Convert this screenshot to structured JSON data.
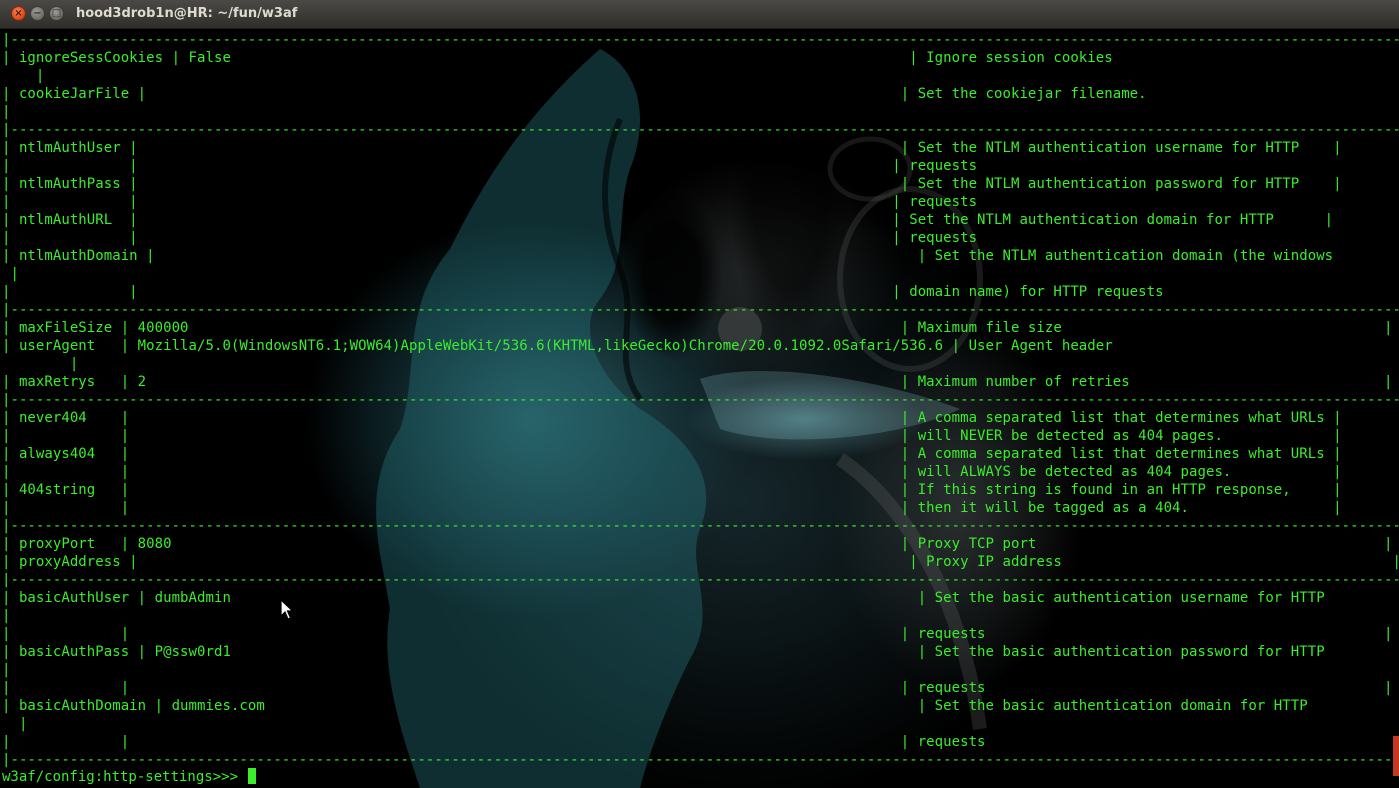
{
  "window": {
    "title": "hood3drob1n@HR: ~/fun/w3af"
  },
  "terminal": {
    "lines": [
      "|----------------------------------------------------------------------------------------------------------------------------------------------------------------------------------------|",
      "| ignoreSessCookies | False                                                                                | Ignore session cookies",
      "    |",
      "| cookieJarFile |                                                                                         | Set the cookiejar filename.",
      "|",
      "|----------------------------------------------------------------------------------------------------------------------------------------------------------------------------------------|",
      "| ntlmAuthUser |                                                                                          | Set the NTLM authentication username for HTTP    |",
      "|              |                                                                                         | requests",
      "| ntlmAuthPass |                                                                                          | Set the NTLM authentication password for HTTP    |",
      "|              |                                                                                         | requests",
      "| ntlmAuthURL  |                                                                                         | Set the NTLM authentication domain for HTTP      |",
      "|              |                                                                                         | requests",
      "| ntlmAuthDomain |                                                                                          | Set the NTLM authentication domain (the windows",
      " |",
      "|              |                                                                                         | domain name) for HTTP requests",
      "|----------------------------------------------------------------------------------------------------------------------------------------------------------------------------------------|",
      "| maxFileSize | 400000                                                                                    | Maximum file size                                      |",
      "| userAgent   | Mozilla/5.0(WindowsNT6.1;WOW64)AppleWebKit/536.6(KHTML,likeGecko)Chrome/20.0.1092.0Safari/536.6 | User Agent header",
      "        |",
      "| maxRetrys   | 2                                                                                         | Maximum number of retries                              |",
      "|----------------------------------------------------------------------------------------------------------------------------------------------------------------------------------------|",
      "| never404    |                                                                                           | A comma separated list that determines what URLs |",
      "|             |                                                                                           | will NEVER be detected as 404 pages.             |",
      "| always404   |                                                                                           | A comma separated list that determines what URLs |",
      "|             |                                                                                           | will ALWAYS be detected as 404 pages.            |",
      "| 404string   |                                                                                           | If this string is found in an HTTP response,     |",
      "|             |                                                                                           | then it will be tagged as a 404.                 |",
      "|----------------------------------------------------------------------------------------------------------------------------------------------------------------------------------------|",
      "| proxyPort   | 8080                                                                                      | Proxy TCP port                                         |",
      "| proxyAddress |                                                                                           | Proxy IP address                                       |",
      "|----------------------------------------------------------------------------------------------------------------------------------------------------------------------------------------|",
      "| basicAuthUser | dumbAdmin                                                                                 | Set the basic authentication username for HTTP",
      "|",
      "|             |                                                                                           | requests                                               |",
      "| basicAuthPass | P@ssw0rd1                                                                                 | Set the basic authentication password for HTTP",
      "|",
      "|             |                                                                                           | requests                                               |",
      "| basicAuthDomain | dummies.com                                                                             | Set the basic authentication domain for HTTP",
      "  |",
      "|             |                                                                                           | requests",
      "|----------------------------------------------------------------------------------------------------------------------------------------------------------------------------------------|"
    ],
    "prompt": "w3af/config:http-settings>>> "
  },
  "colors": {
    "text": "#3bed2c",
    "background": "#000000",
    "titlebar": "#3c3b37"
  }
}
